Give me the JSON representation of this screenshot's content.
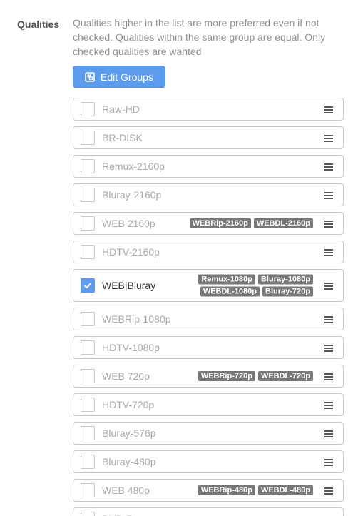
{
  "field": {
    "label": "Qualities",
    "help_text": "Qualities higher in the list are more preferred even if not checked. Qualities within the same group are equal. Only checked qualities are wanted"
  },
  "edit_groups_button": {
    "label": "Edit Groups",
    "icon": "edit-groups-icon"
  },
  "colors": {
    "accent": "#5d9cec",
    "tag_bg": "#777777",
    "border": "#c8c8c8"
  },
  "qualities": [
    {
      "name": "Raw-HD",
      "checked": false,
      "tags": []
    },
    {
      "name": "BR-DISK",
      "checked": false,
      "tags": []
    },
    {
      "name": "Remux-2160p",
      "checked": false,
      "tags": []
    },
    {
      "name": "Bluray-2160p",
      "checked": false,
      "tags": []
    },
    {
      "name": "WEB 2160p",
      "checked": false,
      "tags": [
        [
          "WEBRip-2160p",
          "WEBDL-2160p"
        ]
      ]
    },
    {
      "name": "HDTV-2160p",
      "checked": false,
      "tags": []
    },
    {
      "name": "WEB|Bluray",
      "checked": true,
      "tags": [
        [
          "Remux-1080p",
          "Bluray-1080p"
        ],
        [
          "WEBDL-1080p",
          "Bluray-720p"
        ]
      ]
    },
    {
      "name": "WEBRip-1080p",
      "checked": false,
      "tags": []
    },
    {
      "name": "HDTV-1080p",
      "checked": false,
      "tags": []
    },
    {
      "name": "WEB 720p",
      "checked": false,
      "tags": [
        [
          "WEBRip-720p",
          "WEBDL-720p"
        ]
      ]
    },
    {
      "name": "HDTV-720p",
      "checked": false,
      "tags": []
    },
    {
      "name": "Bluray-576p",
      "checked": false,
      "tags": []
    },
    {
      "name": "Bluray-480p",
      "checked": false,
      "tags": []
    },
    {
      "name": "WEB 480p",
      "checked": false,
      "tags": [
        [
          "WEBRip-480p",
          "WEBDL-480p"
        ]
      ]
    },
    {
      "name": "DVD-R",
      "checked": false,
      "tags": []
    }
  ]
}
